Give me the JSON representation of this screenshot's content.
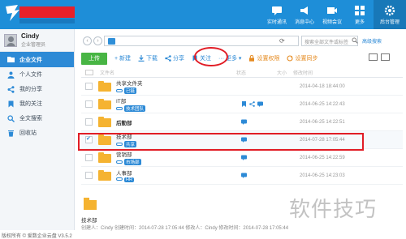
{
  "header": {
    "nav": [
      {
        "label": "实时通讯",
        "icon": "chat-icon"
      },
      {
        "label": "消息中心",
        "icon": "megaphone-icon"
      },
      {
        "label": "视频会议",
        "icon": "video-icon"
      },
      {
        "label": "更多",
        "icon": "grid-icon"
      },
      {
        "label": "后台管理",
        "icon": "gear-icon"
      }
    ],
    "brand_color": "#1e8ed8"
  },
  "user": {
    "name": "Cindy",
    "role": "企业管理员"
  },
  "sidebar": {
    "items": [
      {
        "label": "企业文件",
        "icon": "folder-icon",
        "active": true
      },
      {
        "label": "个人文件",
        "icon": "person-icon"
      },
      {
        "label": "我的分享",
        "icon": "share-icon"
      },
      {
        "label": "我的关注",
        "icon": "bookmark-icon"
      },
      {
        "label": "全文搜索",
        "icon": "search-icon"
      },
      {
        "label": "回收站",
        "icon": "trash-icon"
      }
    ]
  },
  "pathbar": {
    "back": "‹",
    "forward": "›",
    "search_placeholder": "搜索全部文件或标签",
    "advanced_search": "高级搜索"
  },
  "toolbar": {
    "upload": "上传",
    "new": "+ 新建",
    "download": "下载",
    "share": "分享",
    "follow": "关注",
    "more": "··· 更多 ▾",
    "permission": "设置权限",
    "sync": "设置同步"
  },
  "table": {
    "headers": {
      "name": "文件名",
      "status": "状态",
      "size": "大小",
      "time": "修改时间"
    },
    "rows": [
      {
        "name": "共享文件夹",
        "tag": "已链",
        "time": "2014-04-18 18:44:00",
        "checked": false
      },
      {
        "name": "IT部",
        "tag": "技术团队",
        "time": "2014-06-25 14:22:43",
        "checked": false
      },
      {
        "name": "后勤部",
        "tag": "",
        "time": "2014-06-25 14:22:51",
        "checked": false
      },
      {
        "name": "技术部",
        "tag": "共享",
        "time": "2014-07-28 17:05:44",
        "checked": true
      },
      {
        "name": "营销部",
        "tag": "市场部",
        "time": "2014-06-25 14:22:59",
        "checked": false
      },
      {
        "name": "人事部",
        "tag": "HR",
        "time": "2014-06-25 14:23:03",
        "checked": false
      }
    ]
  },
  "details": {
    "title": "技术部",
    "line": "创建人：Cindy  创建时间：2014-07-28 17:05:44  修改人：Cindy  修改时间：2014-07-28 17:05:44"
  },
  "footer": {
    "copyright": "版权所有 © 爱数企业云盘 V3.5.2"
  },
  "watermark": "软件技巧"
}
